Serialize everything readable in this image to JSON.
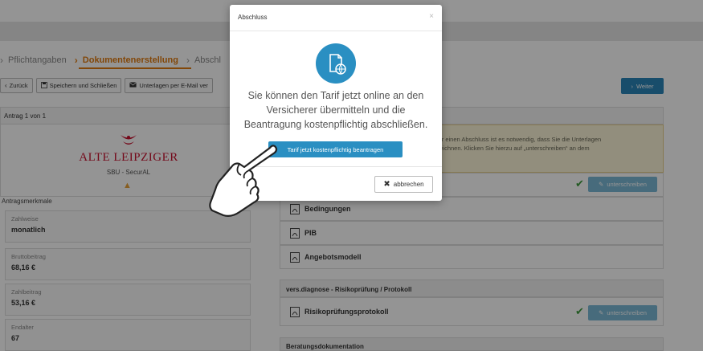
{
  "steps": [
    {
      "label": "Pflichtangaben",
      "active": false
    },
    {
      "label": "Dokumentenerstellung",
      "active": true
    },
    {
      "label": "Abschl",
      "active": false
    }
  ],
  "toolbar": {
    "back_label": "Zurück",
    "save_label": "Speichern und Schließen",
    "email_label": "Unterlagen per E-Mail ver",
    "next_label": "Weiter"
  },
  "left": {
    "antrag_counter": "Antrag 1 von 1",
    "insurer_logo_text": "ALTE LEIPZIGER",
    "product": "SBU - SecurAL",
    "merkmale_label": "Antragsmerkmale",
    "merkmale": [
      {
        "label": "Zahlweise",
        "value": "monatlich"
      },
      {
        "label": "Bruttobeitrag",
        "value": "68,16 €"
      },
      {
        "label": "Zahlbeitrag",
        "value": "53,16 €"
      },
      {
        "label": "Endalter",
        "value": "67"
      }
    ]
  },
  "right": {
    "info_line1": "Für einen Abschluss ist es notwendig, dass Sie die Unterlagen",
    "info_line2": "rzeichnen. Klicken Sie hierzu auf „unterschreiben“ an dem",
    "docs": [
      {
        "label": "Bedingungen"
      },
      {
        "label": "PIB"
      },
      {
        "label": "Angebotsmodell"
      }
    ],
    "sign_label": "unterschreiben",
    "section_risk": "vers.diagnose - Risikoprüfung / Protokoll",
    "risk_doc": "Risikoprüfungsprotokoll",
    "section_advice": "Beratungsdokumentation"
  },
  "modal": {
    "title": "Abschluss",
    "close_glyph": "×",
    "text": "Sie können den Tarif jetzt online an den Versicherer übermitteln und die Beantragung kostenpflichtig abschließen.",
    "primary_label": "Tarif jetzt kostenpflichtig beantragen",
    "cancel_label": "abbrechen"
  },
  "colors": {
    "accent_orange": "#e07b10",
    "primary_blue": "#2a8fc2",
    "brand_red": "#c8102e",
    "success_green": "#3c9a3c"
  },
  "icons": {
    "modal_icon": "document-globe-icon",
    "pointer": "pointing-hand-icon"
  }
}
